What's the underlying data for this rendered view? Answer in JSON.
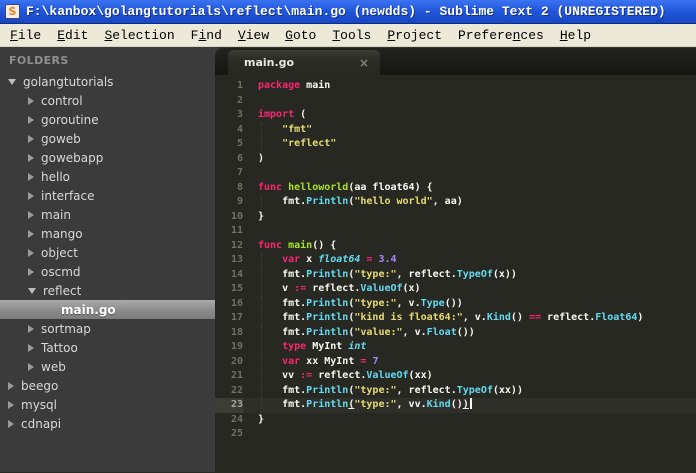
{
  "window": {
    "title": "F:\\kanbox\\golangtutorials\\reflect\\main.go (newdds) - Sublime Text 2 (UNREGISTERED)",
    "icon_letter": "S"
  },
  "menu": {
    "items": [
      {
        "label": "File",
        "underline": 0
      },
      {
        "label": "Edit",
        "underline": 0
      },
      {
        "label": "Selection",
        "underline": 0
      },
      {
        "label": "Find",
        "underline": 1
      },
      {
        "label": "View",
        "underline": 0
      },
      {
        "label": "Goto",
        "underline": 0
      },
      {
        "label": "Tools",
        "underline": 0
      },
      {
        "label": "Project",
        "underline": 0
      },
      {
        "label": "Preferences",
        "underline": 7
      },
      {
        "label": "Help",
        "underline": 0
      }
    ]
  },
  "sidebar": {
    "header": "FOLDERS",
    "tree": [
      {
        "label": "golangtutorials",
        "level": 0,
        "state": "expanded"
      },
      {
        "label": "control",
        "level": 1,
        "state": "collapsed"
      },
      {
        "label": "goroutine",
        "level": 1,
        "state": "collapsed"
      },
      {
        "label": "goweb",
        "level": 1,
        "state": "collapsed"
      },
      {
        "label": "gowebapp",
        "level": 1,
        "state": "collapsed"
      },
      {
        "label": "hello",
        "level": 1,
        "state": "collapsed"
      },
      {
        "label": "interface",
        "level": 1,
        "state": "collapsed"
      },
      {
        "label": "main",
        "level": 1,
        "state": "collapsed"
      },
      {
        "label": "mango",
        "level": 1,
        "state": "collapsed"
      },
      {
        "label": "object",
        "level": 1,
        "state": "collapsed"
      },
      {
        "label": "oscmd",
        "level": 1,
        "state": "collapsed"
      },
      {
        "label": "reflect",
        "level": 1,
        "state": "expanded"
      },
      {
        "label": "main.go",
        "level": 2,
        "state": "file",
        "selected": true
      },
      {
        "label": "sortmap",
        "level": 1,
        "state": "collapsed"
      },
      {
        "label": "Tattoo",
        "level": 1,
        "state": "collapsed"
      },
      {
        "label": "web",
        "level": 1,
        "state": "collapsed"
      },
      {
        "label": "beego",
        "level": 0,
        "state": "collapsed"
      },
      {
        "label": "mysql",
        "level": 0,
        "state": "collapsed"
      },
      {
        "label": "cdnapi",
        "level": 0,
        "state": "collapsed"
      }
    ]
  },
  "tabs": [
    {
      "label": "main.go",
      "close_glyph": "×",
      "active": true
    }
  ],
  "editor": {
    "current_line": 23,
    "lines": [
      {
        "n": 1,
        "t": [
          [
            "kw",
            "package"
          ],
          [
            "pl",
            " main"
          ]
        ]
      },
      {
        "n": 2,
        "t": []
      },
      {
        "n": 3,
        "t": [
          [
            "kw",
            "import"
          ],
          [
            "pl",
            " ("
          ]
        ]
      },
      {
        "n": 4,
        "g": true,
        "t": [
          [
            "pl",
            "    "
          ],
          [
            "str",
            "\"fmt\""
          ]
        ]
      },
      {
        "n": 5,
        "g": true,
        "t": [
          [
            "pl",
            "    "
          ],
          [
            "str",
            "\"reflect\""
          ]
        ]
      },
      {
        "n": 6,
        "t": [
          [
            "pl",
            ")"
          ]
        ]
      },
      {
        "n": 7,
        "t": []
      },
      {
        "n": 8,
        "t": [
          [
            "kw",
            "func"
          ],
          [
            "pl",
            " "
          ],
          [
            "fn",
            "helloworld"
          ],
          [
            "pl",
            "(aa float64) {"
          ]
        ]
      },
      {
        "n": 9,
        "g": true,
        "t": [
          [
            "pl",
            "    fmt."
          ],
          [
            "call",
            "Println"
          ],
          [
            "pl",
            "("
          ],
          [
            "str",
            "\"hello world\""
          ],
          [
            "pl",
            ", aa)"
          ]
        ]
      },
      {
        "n": 10,
        "t": [
          [
            "pl",
            "}"
          ]
        ]
      },
      {
        "n": 11,
        "t": []
      },
      {
        "n": 12,
        "t": [
          [
            "kw",
            "func"
          ],
          [
            "pl",
            " "
          ],
          [
            "fn",
            "main"
          ],
          [
            "pl",
            "() {"
          ]
        ]
      },
      {
        "n": 13,
        "g": true,
        "t": [
          [
            "pl",
            "    "
          ],
          [
            "kw",
            "var"
          ],
          [
            "pl",
            " x "
          ],
          [
            "ty",
            "float64"
          ],
          [
            "pl",
            " "
          ],
          [
            "op",
            "="
          ],
          [
            "pl",
            " "
          ],
          [
            "num",
            "3.4"
          ]
        ]
      },
      {
        "n": 14,
        "g": true,
        "t": [
          [
            "pl",
            "    fmt."
          ],
          [
            "call",
            "Println"
          ],
          [
            "pl",
            "("
          ],
          [
            "str",
            "\"type:\""
          ],
          [
            "pl",
            ", reflect."
          ],
          [
            "call",
            "TypeOf"
          ],
          [
            "pl",
            "(x))"
          ]
        ]
      },
      {
        "n": 15,
        "g": true,
        "t": [
          [
            "pl",
            "    v "
          ],
          [
            "op",
            ":="
          ],
          [
            "pl",
            " reflect."
          ],
          [
            "call",
            "ValueOf"
          ],
          [
            "pl",
            "(x)"
          ]
        ]
      },
      {
        "n": 16,
        "g": true,
        "t": [
          [
            "pl",
            "    fmt."
          ],
          [
            "call",
            "Println"
          ],
          [
            "pl",
            "("
          ],
          [
            "str",
            "\"type:\""
          ],
          [
            "pl",
            ", v."
          ],
          [
            "call",
            "Type"
          ],
          [
            "pl",
            "())"
          ]
        ]
      },
      {
        "n": 17,
        "g": true,
        "t": [
          [
            "pl",
            "    fmt."
          ],
          [
            "call",
            "Println"
          ],
          [
            "pl",
            "("
          ],
          [
            "str",
            "\"kind is float64:\""
          ],
          [
            "pl",
            ", v."
          ],
          [
            "call",
            "Kind"
          ],
          [
            "pl",
            "() "
          ],
          [
            "op",
            "=="
          ],
          [
            "pl",
            " reflect."
          ],
          [
            "call",
            "Float64"
          ],
          [
            "pl",
            ")"
          ]
        ]
      },
      {
        "n": 18,
        "g": true,
        "t": [
          [
            "pl",
            "    fmt."
          ],
          [
            "call",
            "Println"
          ],
          [
            "pl",
            "("
          ],
          [
            "str",
            "\"value:\""
          ],
          [
            "pl",
            ", v."
          ],
          [
            "call",
            "Float"
          ],
          [
            "pl",
            "())"
          ]
        ]
      },
      {
        "n": 19,
        "g": true,
        "t": [
          [
            "pl",
            "    "
          ],
          [
            "kw",
            "type"
          ],
          [
            "pl",
            " MyInt "
          ],
          [
            "ty",
            "int"
          ]
        ]
      },
      {
        "n": 20,
        "g": true,
        "t": [
          [
            "pl",
            "    "
          ],
          [
            "kw",
            "var"
          ],
          [
            "pl",
            " xx MyInt "
          ],
          [
            "op",
            "="
          ],
          [
            "pl",
            " "
          ],
          [
            "num",
            "7"
          ]
        ]
      },
      {
        "n": 21,
        "g": true,
        "t": [
          [
            "pl",
            "    vv "
          ],
          [
            "op",
            ":="
          ],
          [
            "pl",
            " reflect."
          ],
          [
            "call",
            "ValueOf"
          ],
          [
            "pl",
            "(xx)"
          ]
        ]
      },
      {
        "n": 22,
        "g": true,
        "t": [
          [
            "pl",
            "    fmt."
          ],
          [
            "call",
            "Println"
          ],
          [
            "pl",
            "("
          ],
          [
            "str",
            "\"type:\""
          ],
          [
            "pl",
            ", reflect."
          ],
          [
            "call",
            "TypeOf"
          ],
          [
            "pl",
            "(xx))"
          ]
        ]
      },
      {
        "n": 23,
        "g": true,
        "cur": true,
        "cursor": true,
        "t": [
          [
            "pl",
            "    fmt."
          ],
          [
            "call",
            "Println"
          ],
          [
            "pl u",
            "("
          ],
          [
            "str",
            "\"type:\""
          ],
          [
            "pl",
            ", vv."
          ],
          [
            "call",
            "Kind"
          ],
          [
            "pl",
            "()"
          ],
          [
            "pl u",
            ")"
          ]
        ]
      },
      {
        "n": 24,
        "t": [
          [
            "pl",
            "}"
          ]
        ]
      },
      {
        "n": 25,
        "t": []
      }
    ]
  },
  "colors": {
    "titlebar_blue": "#2258dc",
    "menubar_bg": "#ece9d8",
    "sidebar_bg": "#3b3b3b",
    "sidebar_selection": "#8a8a8a",
    "editor_bg": "#272822",
    "keyword_pink": "#f92672",
    "string_yellow": "#e6db74",
    "number_purple": "#ae81ff",
    "function_green": "#a6e22e",
    "call_blue": "#66d9ef",
    "plain_text": "#f8f8f2",
    "icon_orange": "#f08018"
  }
}
